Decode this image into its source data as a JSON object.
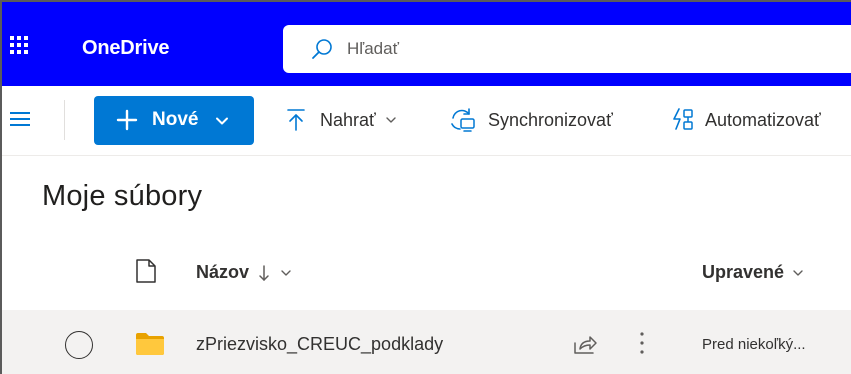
{
  "suitebar": {
    "app_name": "OneDrive",
    "search_placeholder": "Hľadať",
    "bg_color": "#0000ff"
  },
  "commandbar": {
    "new_label": "Nové",
    "upload_label": "Nahrať",
    "sync_label": "Synchronizovať",
    "automate_label": "Automatizovať",
    "accent_color": "#0078d4"
  },
  "page": {
    "title": "Moje súbory"
  },
  "table": {
    "columns": {
      "name": "Názov",
      "modified": "Upravené"
    },
    "rows": [
      {
        "name": "zPriezvisko_CREUC_podklady",
        "type": "folder-icon",
        "modified": "Pred niekoľký..."
      }
    ]
  }
}
